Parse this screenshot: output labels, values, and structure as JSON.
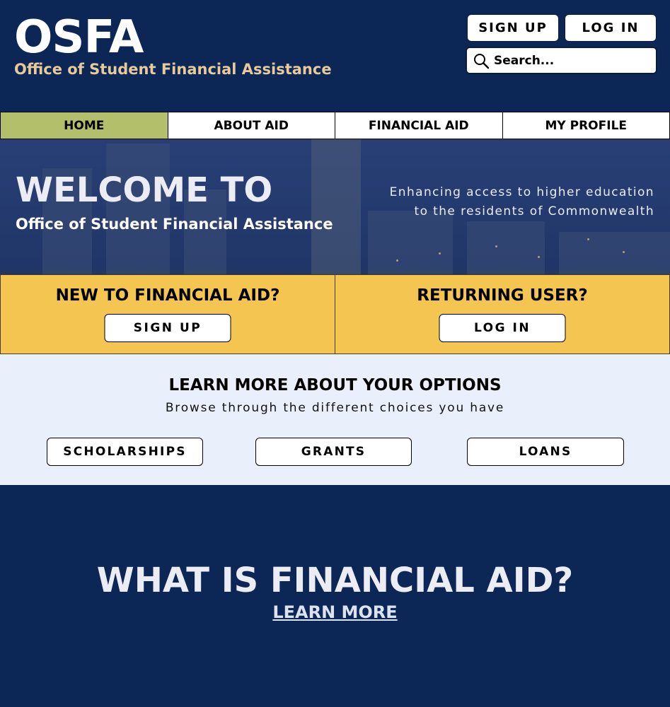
{
  "header": {
    "logo": "OSFA",
    "subtitle": "Office of Student Financial Assistance",
    "signup_label": "SIGN UP",
    "login_label": "LOG IN",
    "search_placeholder": "Search..."
  },
  "nav": {
    "items": [
      {
        "label": "HOME",
        "active": true
      },
      {
        "label": "ABOUT AID",
        "active": false
      },
      {
        "label": "FINANCIAL AID",
        "active": false
      },
      {
        "label": "MY PROFILE",
        "active": false
      }
    ]
  },
  "hero": {
    "title": "WELCOME TO",
    "subtitle": "Office of Student Financial Assistance",
    "tagline_line1": "Enhancing access to higher education",
    "tagline_line2": "to the residents of Commonwealth"
  },
  "cta": {
    "new_title": "NEW TO FINANCIAL AID?",
    "new_button": "SIGN UP",
    "returning_title": "RETURNING USER?",
    "returning_button": "LOG IN"
  },
  "learn": {
    "title": "LEARN MORE ABOUT YOUR OPTIONS",
    "subtitle": "Browse through the different choices you have",
    "options": [
      "SCHOLARSHIPS",
      "GRANTS",
      "LOANS"
    ]
  },
  "what": {
    "title": "WHAT IS FINANCIAL AID?",
    "link": "LEARN MORE"
  },
  "colors": {
    "navy": "#0c2756",
    "gold_text": "#e7c99a",
    "nav_active": "#b4bf6b",
    "cta_yellow": "#f5c552",
    "learn_bg": "#eaf0fb"
  }
}
